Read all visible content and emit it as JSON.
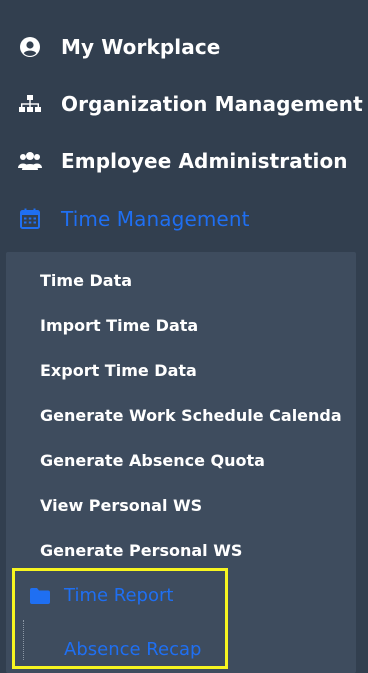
{
  "menu": {
    "items": [
      {
        "label": "My Workplace",
        "icon": "user-circle-icon"
      },
      {
        "label": "Organization Management",
        "icon": "sitemap-icon"
      },
      {
        "label": "Employee Administration",
        "icon": "users-icon"
      },
      {
        "label": "Time Management",
        "icon": "calendar-icon"
      }
    ],
    "submenu": [
      "Time Data",
      "Import Time Data",
      "Export Time Data",
      "Generate Work Schedule Calenda",
      "Generate Absence Quota",
      "View Personal WS",
      "Generate Personal WS"
    ],
    "time_report": {
      "label": "Time Report",
      "icon": "folder-icon"
    },
    "absence_recap": {
      "label": "Absence Recap"
    }
  },
  "colors": {
    "sidebar_bg": "#323f4f",
    "submenu_bg": "#3e4c5e",
    "active_blue": "#1f6ff2",
    "highlight_yellow": "#f7f520"
  }
}
